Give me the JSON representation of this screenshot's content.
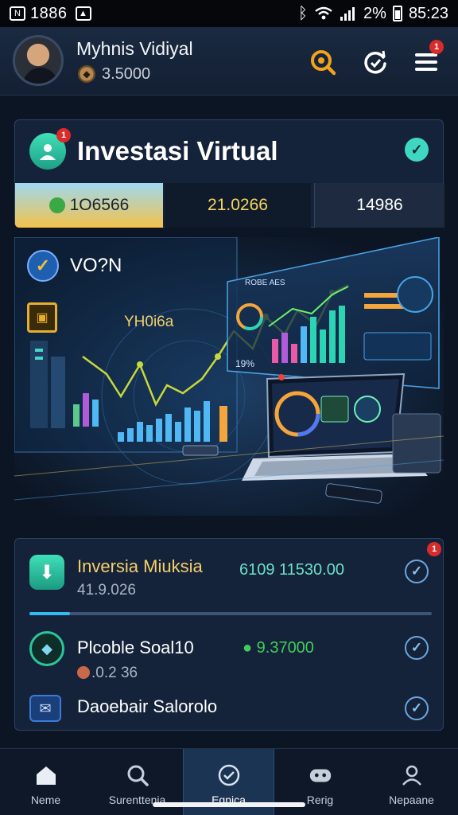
{
  "status_bar": {
    "time_left": "1886",
    "battery": "2%",
    "time_right": "85:23",
    "icons": [
      "bluetooth-icon",
      "wifi-icon",
      "signal-icon",
      "battery-icon"
    ]
  },
  "header": {
    "user_name": "Myhnis Vidiyal",
    "balance": "3.5000",
    "menu_badge": "1"
  },
  "invest_card": {
    "title": "Investasi Virtual",
    "icon_badge": "1",
    "tabs": [
      {
        "label": "1O6566"
      },
      {
        "label": "21.0266"
      },
      {
        "label": "14986"
      }
    ]
  },
  "hero": {
    "label_primary": "VO?N",
    "label_secondary": "YH0i6a",
    "label_screen": "ROBE AES",
    "label_panel": "19%"
  },
  "portfolio": {
    "rows": [
      {
        "title": "Inversia Miuksia",
        "subtitle": "41.9.026",
        "amount": "6109 11530.00",
        "badge": "1"
      },
      {
        "title": "Plcoble Soal10",
        "subtitle": ".0.2 36",
        "amount": "● 9.37000"
      },
      {
        "title": "Daoebair Salorolo"
      }
    ],
    "progress": 0.1
  },
  "bottom_nav": {
    "items": [
      {
        "label": "Neme",
        "icon": "home-icon"
      },
      {
        "label": "Surenttenia",
        "icon": "search-icon"
      },
      {
        "label": "Eqnica",
        "icon": "check-circle-icon"
      },
      {
        "label": "Rerig",
        "icon": "gamepad-icon"
      },
      {
        "label": "Nepaane",
        "icon": "profile-icon"
      }
    ],
    "active_index": 2
  },
  "colors": {
    "background": "#0c1524",
    "card": "#15233a",
    "accent_gold": "#f4cf6b",
    "accent_teal": "#3fd7c2",
    "accent_green": "#3fce5a",
    "badge_red": "#d92b2b"
  }
}
